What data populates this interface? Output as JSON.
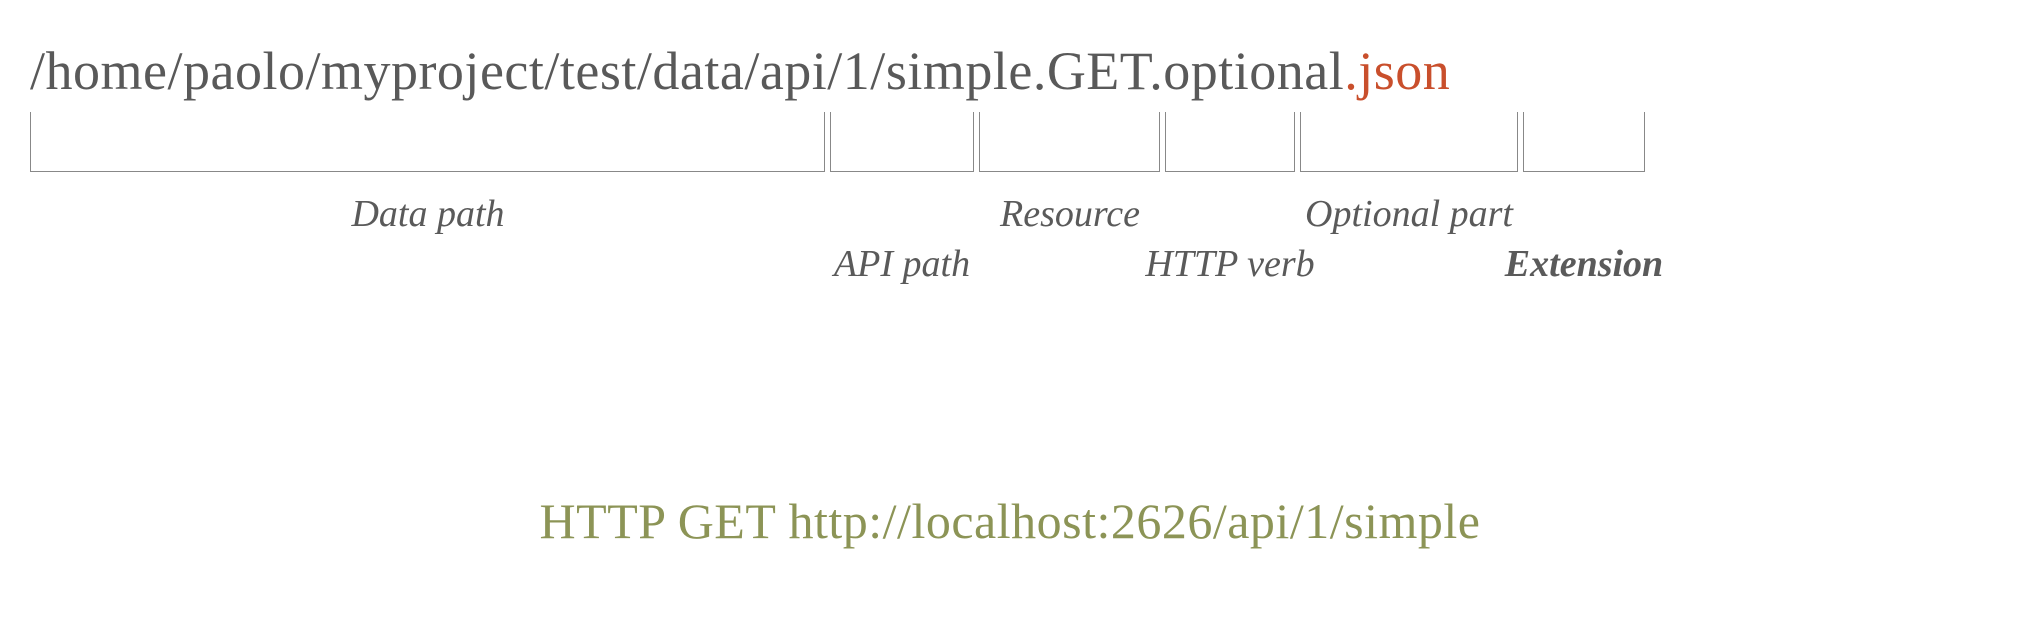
{
  "path": {
    "data_path": "/home/paolo/myproject/test/data",
    "api_path": "/api/1",
    "resource_sep": "/",
    "resource": "simple",
    "verb_sep": ".",
    "http_verb": "GET",
    "optional_sep": ".",
    "optional": "optional",
    "ext_sep": ".",
    "extension": "json"
  },
  "labels": {
    "data_path": "Data path",
    "api_path": "API path",
    "resource": "Resource",
    "http_verb": "HTTP verb",
    "optional": "Optional part",
    "extension": "Extension"
  },
  "request": "HTTP GET http://localhost:2626/api/1/simple",
  "colors": {
    "text_gray": "#595959",
    "label_gray": "#5a5a5a",
    "bracket_gray": "#888888",
    "extension_orange": "#c94f2c",
    "request_olive": "#8c9456"
  }
}
